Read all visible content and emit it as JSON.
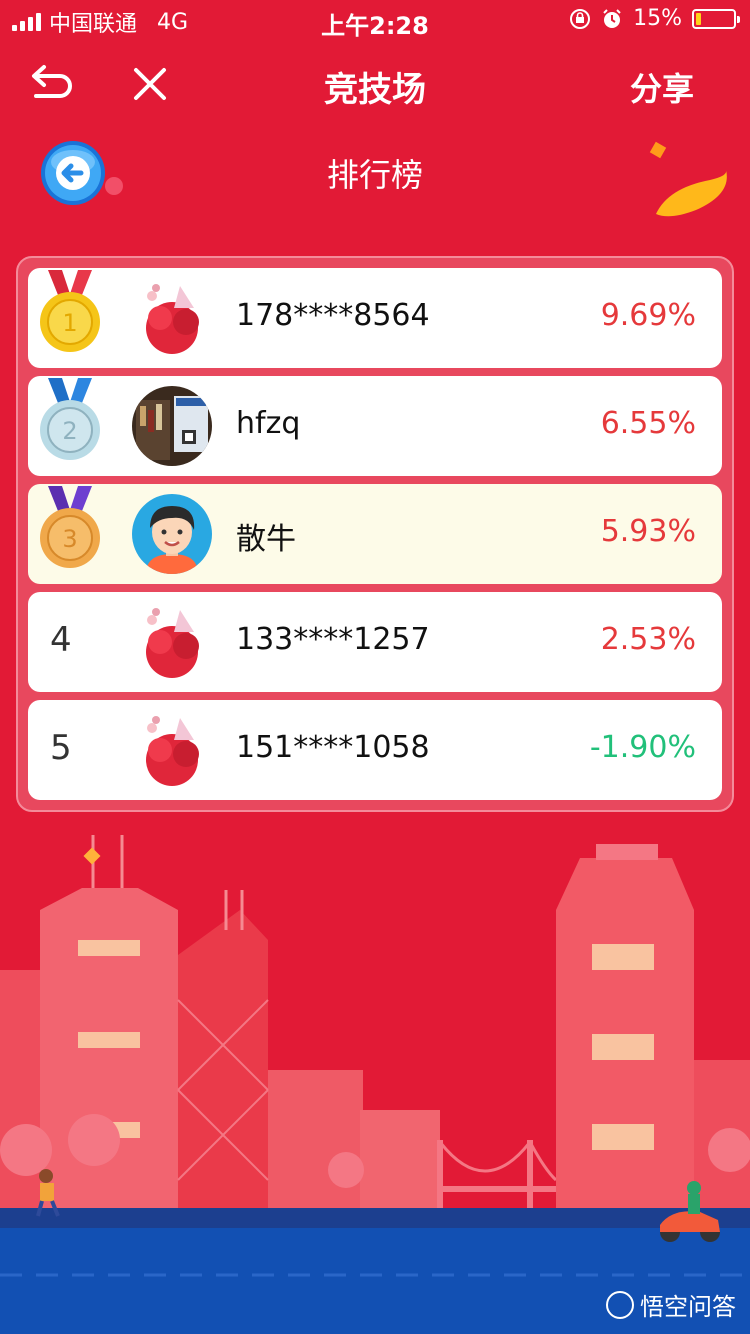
{
  "status_bar": {
    "carrier": "中国联通",
    "network": "4G",
    "time": "上午2:28",
    "battery": "15%"
  },
  "navbar": {
    "title": "竞技场",
    "share_label": "分享"
  },
  "page": {
    "subtitle": "排行榜"
  },
  "leaderboard": [
    {
      "rank": "1",
      "name": "178****8564",
      "value": "9.69%"
    },
    {
      "rank": "2",
      "name": "hfzq",
      "value": "6.55%"
    },
    {
      "rank": "3",
      "name": "散牛",
      "value": "5.93%"
    },
    {
      "rank": "4",
      "name": "133****1257",
      "value": "2.53%"
    },
    {
      "rank": "5",
      "name": "151****1058",
      "value": "-1.90%"
    }
  ],
  "watermark": "悟空问答",
  "colors": {
    "background": "#e21a36",
    "positive": "#e5393b",
    "negative": "#21c07a",
    "highlight_row": "#fdfbe8"
  },
  "icons": {
    "back": "back-arrow-icon",
    "close": "close-icon",
    "rank_back": "blue-circle-back-icon",
    "gold": "gold-medal-icon",
    "silver": "silver-medal-icon",
    "bronze": "bronze-medal-icon"
  }
}
